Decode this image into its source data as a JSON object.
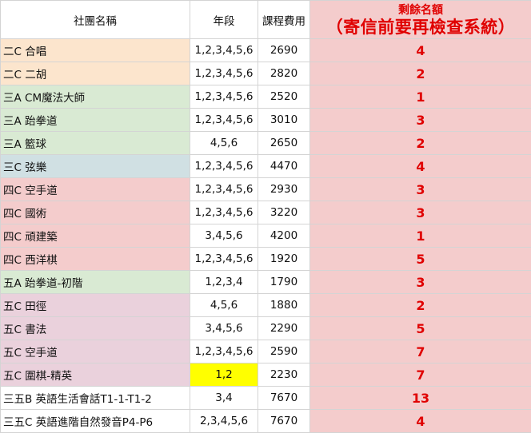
{
  "colors": {
    "peach": "#fce5cd",
    "green": "#d9ead3",
    "blue": "#d0e0e3",
    "red": "#f4cccc",
    "purple": "#ead1dc",
    "white": "#ffffff",
    "accent_red": "#e00000",
    "highlight_yellow": "#ffff00"
  },
  "headers": {
    "name": "社團名稱",
    "grade": "年段",
    "fee": "課程費用",
    "remain_title": "剩餘名額",
    "remain_note": "（寄信前要再檢查系統）"
  },
  "rows": [
    {
      "name": "二C 合唱",
      "grade": "1,2,3,4,5,6",
      "fee": "2690",
      "remain": "4",
      "color": "peach"
    },
    {
      "name": "二C 二胡",
      "grade": "1,2,3,4,5,6",
      "fee": "2820",
      "remain": "2",
      "color": "peach"
    },
    {
      "name": "三A CM魔法大師",
      "grade": "1,2,3,4,5,6",
      "fee": "2520",
      "remain": "1",
      "color": "green"
    },
    {
      "name": "三A 跆拳道",
      "grade": "1,2,3,4,5,6",
      "fee": "3010",
      "remain": "3",
      "color": "green"
    },
    {
      "name": "三A 籃球",
      "grade": "4,5,6",
      "fee": "2650",
      "remain": "2",
      "color": "green"
    },
    {
      "name": "三C 弦樂",
      "grade": "1,2,3,4,5,6",
      "fee": "4470",
      "remain": "4",
      "color": "blue"
    },
    {
      "name": "四C 空手道",
      "grade": "1,2,3,4,5,6",
      "fee": "2930",
      "remain": "3",
      "color": "red"
    },
    {
      "name": "四C 國術",
      "grade": "1,2,3,4,5,6",
      "fee": "3220",
      "remain": "3",
      "color": "red"
    },
    {
      "name": "四C 頑建築",
      "grade": "3,4,5,6",
      "fee": "4200",
      "remain": "1",
      "color": "red"
    },
    {
      "name": "四C 西洋棋",
      "grade": "1,2,3,4,5,6",
      "fee": "1920",
      "remain": "5",
      "color": "red"
    },
    {
      "name": "五A 跆拳道-初階",
      "grade": "1,2,3,4",
      "fee": "1790",
      "remain": "3",
      "color": "green"
    },
    {
      "name": "五C 田徑",
      "grade": "4,5,6",
      "fee": "1880",
      "remain": "2",
      "color": "purple"
    },
    {
      "name": "五C 書法",
      "grade": "3,4,5,6",
      "fee": "2290",
      "remain": "5",
      "color": "purple"
    },
    {
      "name": "五C 空手道",
      "grade": "1,2,3,4,5,6",
      "fee": "2590",
      "remain": "7",
      "color": "purple"
    },
    {
      "name": "五C 圍棋-精英",
      "grade": "1,2",
      "fee": "2230",
      "remain": "7",
      "color": "purple",
      "grade_highlight": true
    },
    {
      "name": "三五B 英語生活會話T1-1-T1-2",
      "grade": "3,4",
      "fee": "7670",
      "remain": "13",
      "color": "white"
    },
    {
      "name": "三五C 英語進階自然發音P4-P6",
      "grade": "2,3,4,5,6",
      "fee": "7670",
      "remain": "4",
      "color": "white"
    }
  ]
}
